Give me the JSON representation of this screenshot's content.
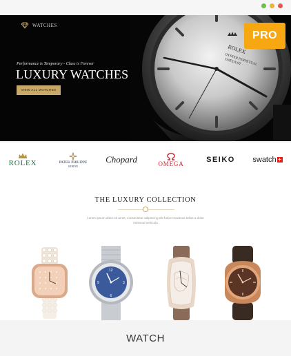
{
  "window": {
    "controls": [
      "green-dot",
      "yellow-dot",
      "red-dot"
    ]
  },
  "hero": {
    "logo_text": "WATCHES",
    "tagline": "Performance is Temporary - Class is Forever",
    "headline": "LUXURY WATCHES",
    "button_label": "VIEW ALL WATCHES",
    "watch_dial_brand": "ROLEX",
    "watch_dial_line1": "OYSTER PERPETUAL",
    "watch_dial_line2": "DATEJUST"
  },
  "badge": {
    "label": "PRO",
    "color": "#f6a711"
  },
  "brands": {
    "rolex": "ROLEX",
    "patek": "PATEK PHILIPPE",
    "patek_sub": "GENEVE",
    "chopard": "Chopard",
    "omega": "OMEGA",
    "seiko": "SEIKO",
    "swatch": "swatch",
    "swatch_plus": "+"
  },
  "collection": {
    "title": "THE LUXURY COLLECTION",
    "description": "Lorem ipsum dolor sit amet, consectetur adipiscing elit fusce maximus tellus a dolor euismod vehicula",
    "products": [
      {
        "name": "diamond-cushion-watch",
        "icon": "watch-icon"
      },
      {
        "name": "blue-dial-steel-watch",
        "icon": "watch-icon"
      },
      {
        "name": "tonneau-diamond-watch",
        "icon": "watch-icon"
      },
      {
        "name": "brown-dial-gold-watch",
        "icon": "watch-icon"
      }
    ]
  },
  "footer": {
    "label": "WATCH"
  }
}
